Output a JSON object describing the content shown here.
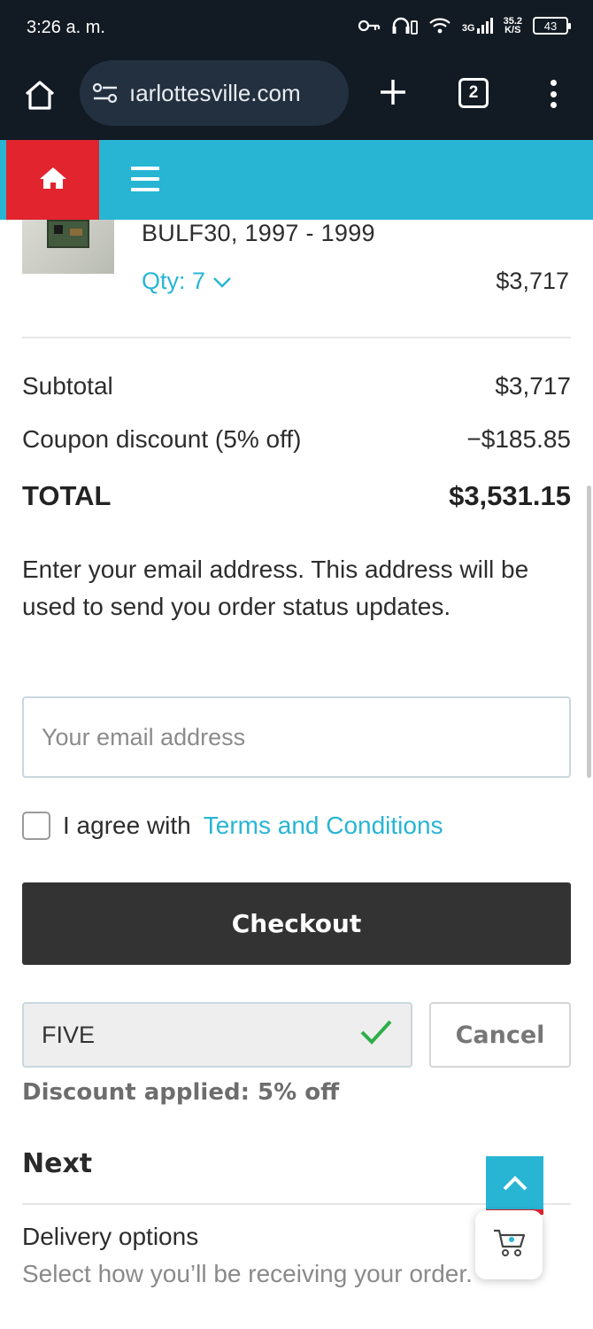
{
  "status_bar": {
    "time": "3:26 a. m.",
    "network": "3G",
    "speed_value": "35.2",
    "speed_unit": "K/S",
    "battery": "43"
  },
  "browser": {
    "url": "ıarlottesville.com",
    "tab_count": "2"
  },
  "cart": {
    "item_name": "BULF30, 1997 - 1999",
    "qty_label": "Qty: 7",
    "item_price": "$3,717"
  },
  "totals": {
    "subtotal_label": "Subtotal",
    "subtotal_value": "$3,717",
    "discount_label": "Coupon discount (5% off)",
    "discount_value": "−$185.85",
    "total_label": "TOTAL",
    "total_value": "$3,531.15"
  },
  "email": {
    "note": "Enter your email address. This address will be used to send you order status updates.",
    "placeholder": "Your email address"
  },
  "agree": {
    "text": "I agree with",
    "link": "Terms and Conditions"
  },
  "checkout_label": "Checkout",
  "coupon": {
    "code": "FIVE",
    "cancel_label": "Cancel",
    "applied_msg": "Discount applied: 5% off"
  },
  "next": {
    "title": "Next",
    "delivery_title": "Delivery options",
    "delivery_sub": "Select how you’ll be receiving your order."
  },
  "colors": {
    "accent": "#28b5d4",
    "brand_red": "#e2242e",
    "dark": "#333333",
    "success": "#2eae4a"
  },
  "icons": {
    "status": [
      "key-icon",
      "headset-icon",
      "wifi-icon",
      "signal-icon",
      "battery-icon"
    ],
    "browser": [
      "home-icon",
      "site-settings-icon",
      "plus-icon",
      "tabs-icon",
      "more-icon"
    ],
    "site": [
      "home-icon",
      "hamburger-icon"
    ],
    "other": [
      "chevron-down-icon",
      "check-icon",
      "chevron-up-icon",
      "cart-icon"
    ]
  }
}
